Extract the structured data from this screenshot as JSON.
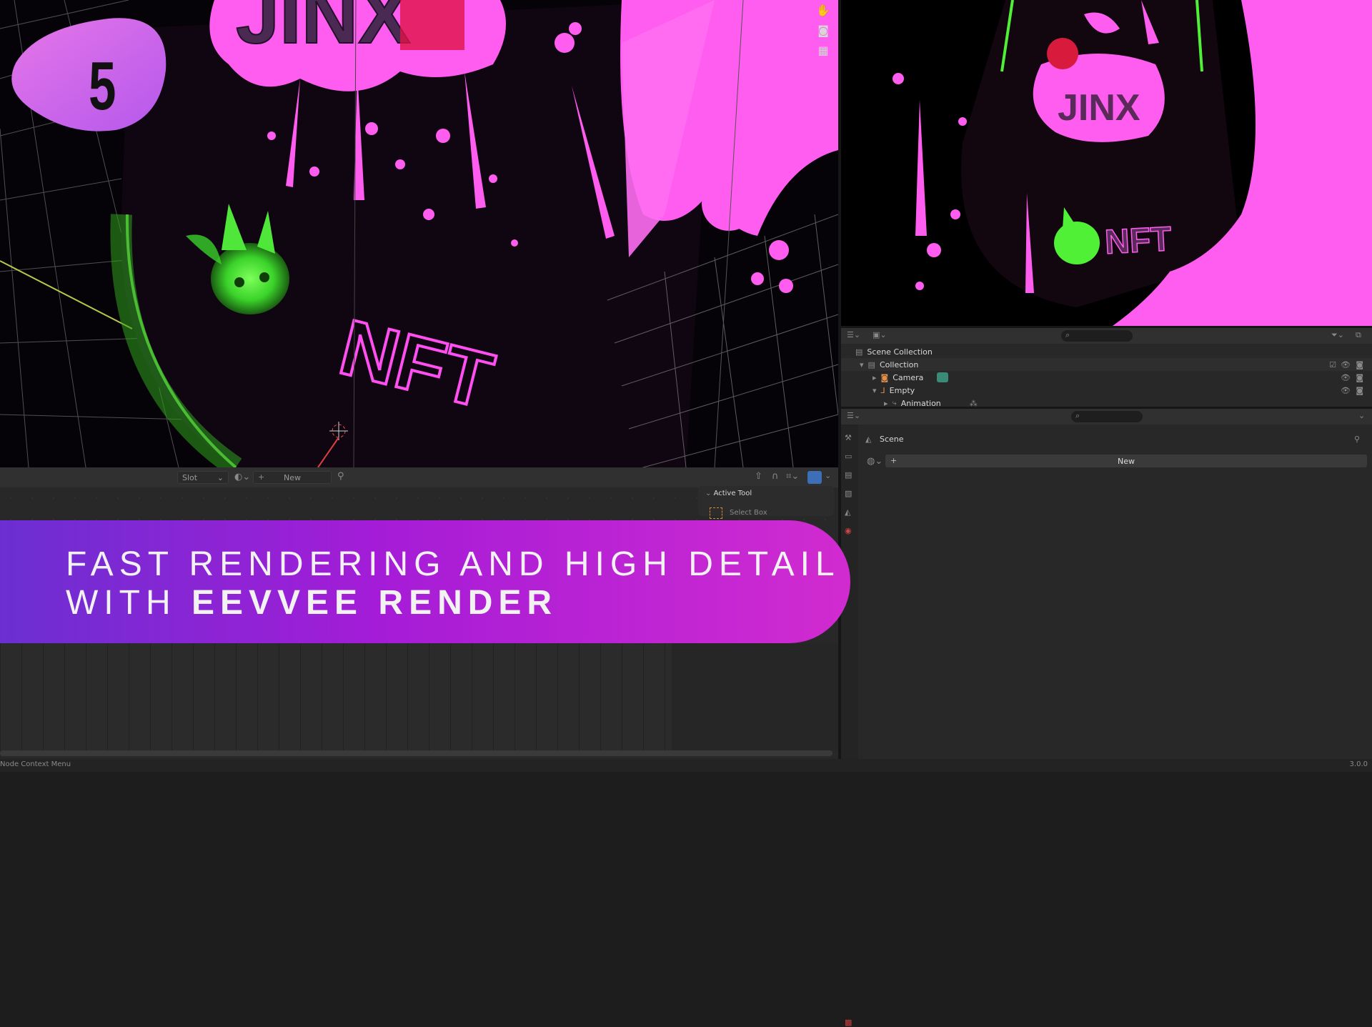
{
  "badge": {
    "number": "5"
  },
  "banner": {
    "line1": "FAST RENDERING AND HIGH DETAIL",
    "line2_prefix": "WITH ",
    "line2_bold": "EEVVEE RENDER"
  },
  "viewport": {
    "scene_text_1": "JINX",
    "scene_text_2": "NFT",
    "gizmo_icons": [
      "hand-icon",
      "camera-icon",
      "grid-icon"
    ]
  },
  "camera_view": {
    "scene_text_1": "JINX",
    "scene_text_2": "NFT"
  },
  "shader_header": {
    "slot_label": "Slot",
    "new_label": "New"
  },
  "sidebar": {
    "active_tool_title": "Active Tool",
    "tool_name": "Select Box"
  },
  "outliner": {
    "rows": [
      {
        "label": "Scene Collection",
        "depth": 0
      },
      {
        "label": "Collection",
        "depth": 1
      },
      {
        "label": "Camera",
        "depth": 2
      },
      {
        "label": "Empty",
        "depth": 2
      },
      {
        "label": "Animation",
        "depth": 3
      }
    ]
  },
  "properties": {
    "scene_label": "Scene",
    "new_label": "New"
  },
  "status_bar": {
    "left_text": "Node Context Menu",
    "version": "3.0.0"
  },
  "colors": {
    "accent_pink": "#ff5cf0",
    "accent_green": "#56ff3c",
    "banner_start": "#6b2fd1",
    "banner_end": "#d12bd0"
  }
}
